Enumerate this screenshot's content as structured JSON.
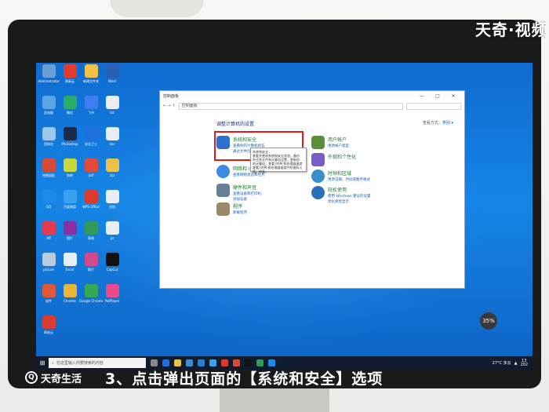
{
  "watermark": {
    "top": "天奇·视频"
  },
  "caption": {
    "logo": "天奇生活",
    "logo_mark": "Q",
    "text": "3、点击弹出页面的【系统和安全】选项"
  },
  "desktop_icons": [
    {
      "label": "Administrator",
      "color": "#6a9ed8"
    },
    {
      "label": "网易云",
      "color": "#e33b2e"
    },
    {
      "label": "新建文件夹",
      "color": "#f0c24d"
    },
    {
      "label": "Word",
      "color": "#2b5fb3"
    },
    {
      "label": "此电脑",
      "color": "#58a6e8"
    },
    {
      "label": "微信",
      "color": "#2aae67"
    },
    {
      "label": "飞书",
      "color": "#3d7ef0"
    },
    {
      "label": "txt",
      "color": "#e8eef5"
    },
    {
      "label": "回收站",
      "color": "#9cc6ee"
    },
    {
      "label": "Photoshop",
      "color": "#1b2a4a"
    },
    {
      "label": "安全卫士",
      "color": "#1f6fe0"
    },
    {
      "label": "doc",
      "color": "#e8eef5"
    },
    {
      "label": "控制面板",
      "color": "#d84a38"
    },
    {
      "label": "剪映",
      "color": "#c8d83a"
    },
    {
      "label": "pdf",
      "color": "#e14a3a"
    },
    {
      "label": "zip",
      "color": "#e8c24a"
    },
    {
      "label": "QQ",
      "color": "#1f8be6"
    },
    {
      "label": "百度网盘",
      "color": "#3aa1ef"
    },
    {
      "label": "WPS Office",
      "color": "#d93b2e"
    },
    {
      "label": "文档",
      "color": "#e8eef5"
    },
    {
      "label": "Aff",
      "color": "#e23a4f"
    },
    {
      "label": "图片",
      "color": "#8a2fa0"
    },
    {
      "label": "表格",
      "color": "#2f9a5a"
    },
    {
      "label": "ps",
      "color": "#e8eef5"
    },
    {
      "label": "picture",
      "color": "#b9cbe0"
    },
    {
      "label": "Excel",
      "color": "#e8eef5"
    },
    {
      "label": "照片",
      "color": "#d24a8c"
    },
    {
      "label": "CapCut",
      "color": "#111111"
    },
    {
      "label": "软件",
      "color": "#e0573a"
    },
    {
      "label": "Chrome",
      "color": "#e8b43a"
    },
    {
      "label": "Google Chrome",
      "color": "#34a853"
    },
    {
      "label": "PotPlayer",
      "color": "#e94a8a"
    },
    {
      "label": "网易云",
      "color": "#dc3b32"
    }
  ],
  "window": {
    "title": "控制面板",
    "controls": [
      "—",
      "□",
      "✕"
    ],
    "nav": "← → ↑",
    "path": "控制面板",
    "heading": "调整计算机的设置",
    "view_label": "查看方式：",
    "view_value": "类别 ▾",
    "categories": [
      {
        "head": "系统和安全",
        "links": [
          "查看你的计算机状态",
          "通过文件历史记录保存你的文件备份副本"
        ],
        "color": "#2e6fd0"
      },
      {
        "head": "网络和 Internet",
        "links": [
          "查看网络状态和任务"
        ],
        "color": "#3d8be0"
      },
      {
        "head": "硬件和声音",
        "links": [
          "查看设备和打印机",
          "添加设备"
        ],
        "color": "#6a7f96"
      },
      {
        "head": "程序",
        "links": [
          "卸载程序"
        ],
        "color": "#9a8a6a"
      },
      {
        "head": "用户帐户",
        "links": [
          "更改帐户类型"
        ],
        "color": "#5a8f3a"
      },
      {
        "head": "外观和个性化",
        "links": [],
        "color": "#7a5ac8"
      },
      {
        "head": "时钟和区域",
        "links": [
          "更改日期、时间或数字格式"
        ],
        "color": "#3a8ec8"
      },
      {
        "head": "轻松使用",
        "links": [
          "使用 Windows 建议的设置",
          "优化视觉显示"
        ],
        "color": "#2a6fb8"
      }
    ],
    "tooltip": [
      "系统和安全",
      "查看并更改系统和安全状态，备份",
      "并还原文件和计算机设置，更新你",
      "的计算机，查看 RAM 和处理器速度",
      "查看 RAM 和处理器速度并检查防火",
      "墙。修复。"
    ]
  },
  "taskbar": {
    "search_placeholder": "在这里输入你要搜索的内容",
    "apps": [
      "#888888",
      "#1f6fe0",
      "#e8c24a",
      "#3a8fd8",
      "#2a7fd0",
      "#3aa1ef",
      "#d93b2e",
      "#d84a38",
      "#111111",
      "#2f9a5a",
      "#1f8be6"
    ],
    "weather": "27°C 多云",
    "time": "13",
    "date": "202"
  },
  "overlay": {
    "speed": "35%"
  }
}
